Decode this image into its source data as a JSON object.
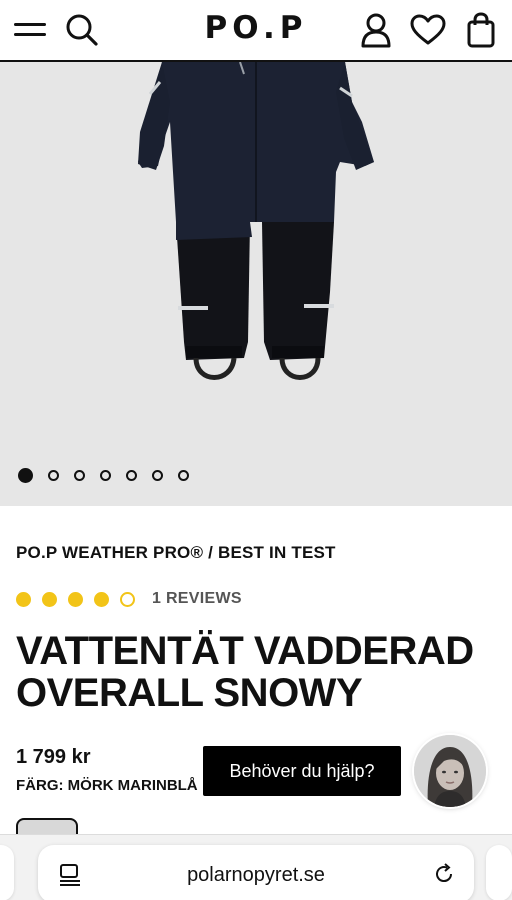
{
  "header": {
    "logo": "PO.P",
    "icons": [
      "menu-icon",
      "search-icon",
      "account-icon",
      "wishlist-icon",
      "bag-icon"
    ]
  },
  "gallery": {
    "image_count": 7,
    "active_index": 0
  },
  "product": {
    "brand_line": "PO.P WEATHER PRO® / BEST IN TEST",
    "rating": {
      "filled": 4,
      "total": 5,
      "reviews_label": "1 REVIEWS"
    },
    "title": "VATTENTÄT VADDERAD OVERALL SNOWY",
    "price": "1 799 kr",
    "color_label": "FÄRG: MÖRK MARINBLÅ"
  },
  "help": {
    "label": "Behöver du hjälp?"
  },
  "browser": {
    "url": "polarnopyret.se"
  },
  "colors": {
    "star": "#f2c418",
    "header_text": "#111111",
    "gallery_bg": "#e6e6e6",
    "help_bg": "#000000"
  }
}
